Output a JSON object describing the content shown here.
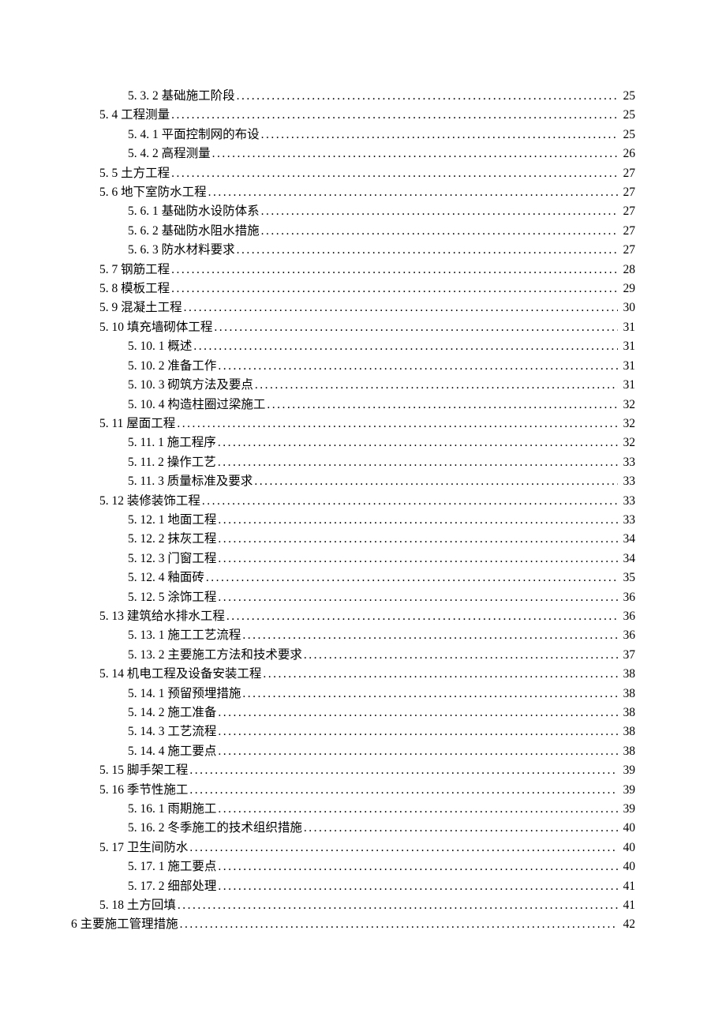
{
  "toc": [
    {
      "level": 3,
      "label": "5. 3. 2 基础施工阶段",
      "page": "25"
    },
    {
      "level": 2,
      "label": "5. 4 工程测量",
      "page": "25"
    },
    {
      "level": 3,
      "label": "5. 4. 1 平面控制网的布设",
      "page": "25"
    },
    {
      "level": 3,
      "label": "5. 4. 2 高程测量",
      "page": "26"
    },
    {
      "level": 2,
      "label": "5. 5 土方工程",
      "page": "27"
    },
    {
      "level": 2,
      "label": "5. 6 地下室防水工程",
      "page": "27"
    },
    {
      "level": 3,
      "label": "5. 6. 1 基础防水设防体系",
      "page": "27"
    },
    {
      "level": 3,
      "label": "5. 6. 2 基础防水阻水措施",
      "page": "27"
    },
    {
      "level": 3,
      "label": "5. 6. 3 防水材料要求",
      "page": "27"
    },
    {
      "level": 2,
      "label": "5. 7 钢筋工程",
      "page": "28"
    },
    {
      "level": 2,
      "label": "5. 8 模板工程",
      "page": "29"
    },
    {
      "level": 2,
      "label": "5. 9 混凝土工程 ",
      "page": "30"
    },
    {
      "level": 2,
      "label": "5. 10 填充墙砌体工程",
      "page": "31"
    },
    {
      "level": 3,
      "label": "5. 10. 1 概述",
      "page": "31"
    },
    {
      "level": 3,
      "label": "5. 10. 2 准备工作",
      "page": "31"
    },
    {
      "level": 3,
      "label": "5. 10. 3 砌筑方法及要点",
      "page": "31"
    },
    {
      "level": 3,
      "label": "5. 10. 4 构造柱圈过梁施工",
      "page": " 32"
    },
    {
      "level": 2,
      "label": "5. 11 屋面工程",
      "page": "32"
    },
    {
      "level": 3,
      "label": "5. 11. 1 施工程序",
      "page": "32"
    },
    {
      "level": 3,
      "label": "5. 11. 2 操作工艺",
      "page": "33"
    },
    {
      "level": 3,
      "label": "5. 11. 3 质量标准及要求",
      "page": "33"
    },
    {
      "level": 2,
      "label": "5. 12 装修装饰工程",
      "page": "33"
    },
    {
      "level": 3,
      "label": "5. 12. 1 地面工程",
      "page": " 33"
    },
    {
      "level": 3,
      "label": "5. 12. 2 抹灰工程",
      "page": "34"
    },
    {
      "level": 3,
      "label": "5. 12. 3 门窗工程",
      "page": "34"
    },
    {
      "level": 3,
      "label": "5. 12. 4 釉面砖",
      "page": "35"
    },
    {
      "level": 3,
      "label": "5. 12. 5 涂饰工程",
      "page": "36"
    },
    {
      "level": 2,
      "label": "5. 13 建筑给水排水工程",
      "page": "36"
    },
    {
      "level": 3,
      "label": "5. 13. 1 施工工艺流程",
      "page": "36"
    },
    {
      "level": 3,
      "label": "5. 13. 2 主要施工方法和技术要求",
      "page": "37"
    },
    {
      "level": 2,
      "label": "5. 14 机电工程及设备安装工程",
      "page": "38"
    },
    {
      "level": 3,
      "label": "5. 14. 1 预留预埋措施",
      "page": "38"
    },
    {
      "level": 3,
      "label": "5. 14. 2 施工准备",
      "page": "38"
    },
    {
      "level": 3,
      "label": "5. 14. 3 工艺流程",
      "page": "38"
    },
    {
      "level": 3,
      "label": "5. 14. 4 施工要点",
      "page": "38"
    },
    {
      "level": 2,
      "label": "5. 15 脚手架工程",
      "page": "39"
    },
    {
      "level": 2,
      "label": "5. 16 季节性施工",
      "page": "39"
    },
    {
      "level": 3,
      "label": "5. 16. 1 雨期施工",
      "page": "39"
    },
    {
      "level": 3,
      "label": "5. 16. 2 冬季施工的技术组织措施",
      "page": "40"
    },
    {
      "level": 2,
      "label": "5. 17 卫生间防水",
      "page": "40"
    },
    {
      "level": 3,
      "label": "5. 17. 1 施工要点",
      "page": "40"
    },
    {
      "level": 3,
      "label": "5. 17. 2 细部处理",
      "page": "41"
    },
    {
      "level": 2,
      "label": "5. 18 土方回填",
      "page": "41"
    },
    {
      "level": 1,
      "label": "6 主要施工管理措施",
      "page": "42"
    }
  ]
}
